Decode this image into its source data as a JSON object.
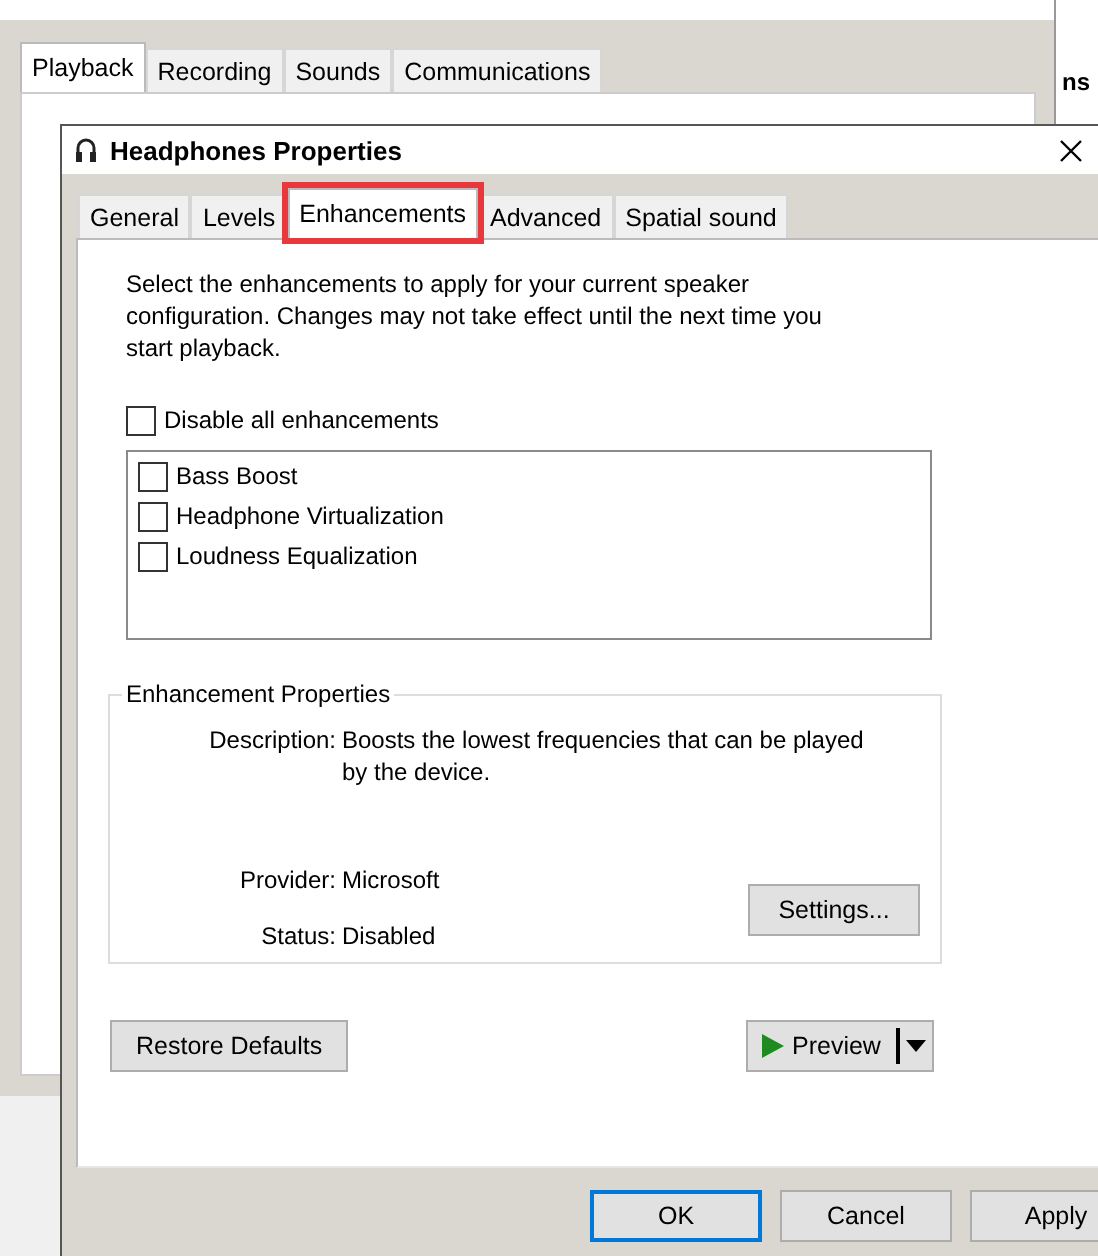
{
  "background_window": {
    "tabs": [
      {
        "label": "Playback",
        "selected": true
      },
      {
        "label": "Recording",
        "selected": false
      },
      {
        "label": "Sounds",
        "selected": false
      },
      {
        "label": "Communications",
        "selected": false
      }
    ]
  },
  "far_window": {
    "partial_text": "ns"
  },
  "dialog": {
    "title": "Headphones Properties",
    "tabs": [
      {
        "label": "General",
        "selected": false,
        "highlighted": false
      },
      {
        "label": "Levels",
        "selected": false,
        "highlighted": false
      },
      {
        "label": "Enhancements",
        "selected": true,
        "highlighted": true
      },
      {
        "label": "Advanced",
        "selected": false,
        "highlighted": false
      },
      {
        "label": "Spatial sound",
        "selected": false,
        "highlighted": false
      }
    ],
    "intro": "Select the enhancements to apply for your current speaker configuration. Changes may not take effect until the next time you start playback.",
    "disable_all": {
      "label": "Disable all enhancements",
      "checked": false
    },
    "enhancements": [
      {
        "label": "Bass Boost",
        "checked": false
      },
      {
        "label": "Headphone Virtualization",
        "checked": false
      },
      {
        "label": "Loudness Equalization",
        "checked": false
      }
    ],
    "properties": {
      "title": "Enhancement Properties",
      "description_label": "Description:",
      "description": "Boosts the lowest frequencies that can be played by the device.",
      "provider_label": "Provider:",
      "provider": "Microsoft",
      "status_label": "Status:",
      "status": "Disabled",
      "settings_button": "Settings..."
    },
    "restore_button": "Restore Defaults",
    "preview_button": "Preview",
    "buttons": [
      {
        "label": "OK",
        "selected": true
      },
      {
        "label": "Cancel",
        "selected": false
      },
      {
        "label": "Apply",
        "selected": false
      }
    ]
  }
}
